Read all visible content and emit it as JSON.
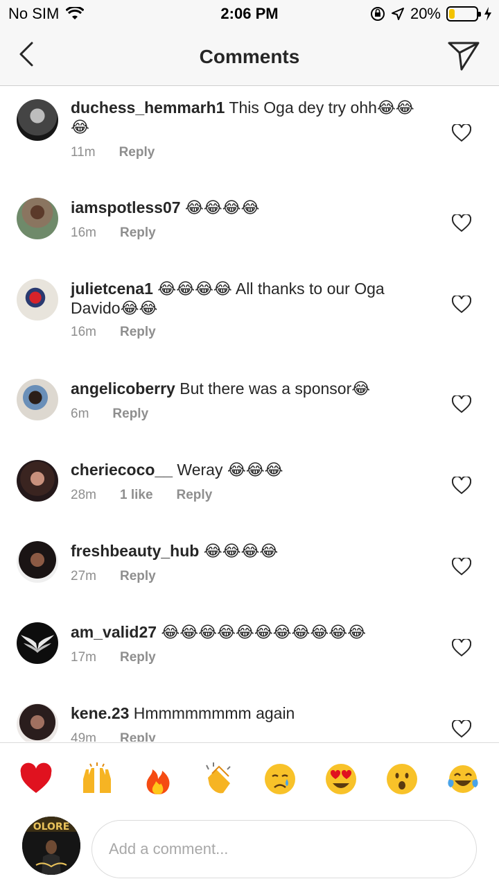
{
  "status_bar": {
    "carrier": "No SIM",
    "time": "2:06 PM",
    "battery": "20%",
    "battery_level": 0.2,
    "icons": [
      "wifi-icon",
      "orientation-lock-icon",
      "location-arrow-icon",
      "battery-icon",
      "charging-bolt-icon"
    ]
  },
  "header": {
    "title": "Comments",
    "icons": [
      "chevron-left-icon",
      "paper-plane-icon"
    ]
  },
  "comments": [
    {
      "username": "duchess_hemmarh1",
      "text": "This Oga dey try ohh😂😂😂",
      "time": "11m",
      "likes": "",
      "reply": "Reply"
    },
    {
      "username": "iamspotless07",
      "text": "😂😂😂😂",
      "time": "16m",
      "likes": "",
      "reply": "Reply"
    },
    {
      "username": "julietcena1",
      "text": "😂😂😂😂 All thanks to our Oga Davido😂😂",
      "time": "16m",
      "likes": "",
      "reply": "Reply"
    },
    {
      "username": "angelicoberry",
      "text": "But there was a sponsor😂",
      "time": "6m",
      "likes": "",
      "reply": "Reply"
    },
    {
      "username": "cheriecoco__",
      "text": "Weray 😂😂😂",
      "time": "28m",
      "likes": "1 like",
      "reply": "Reply"
    },
    {
      "username": "freshbeauty_hub",
      "text": "😂😂😂😂",
      "time": "27m",
      "likes": "",
      "reply": "Reply"
    },
    {
      "username": "am_valid27",
      "text": "😂😂😂😂😂😂😂😂😂😂😂",
      "time": "17m",
      "likes": "",
      "reply": "Reply"
    },
    {
      "username": "kene.23",
      "text": "Hmmmmmmmm again",
      "time": "49m",
      "likes": "",
      "reply": "Reply"
    }
  ],
  "reactions": [
    "❤️",
    "🙌",
    "🔥",
    "👏",
    "😢",
    "😍",
    "😮",
    "😂"
  ],
  "reaction_icons": [
    "red-heart-icon",
    "raising-hands-icon",
    "fire-icon",
    "clapping-hands-icon",
    "crying-face-icon",
    "heart-eyes-icon",
    "surprised-face-icon",
    "tears-of-joy-icon"
  ],
  "composer": {
    "placeholder": "Add a comment...",
    "avatar_text": "OLORE"
  },
  "colors": {
    "header_bg": "#f7f7f7",
    "text": "#262626",
    "meta": "#8e8e8e",
    "battery": "#f3c300"
  }
}
